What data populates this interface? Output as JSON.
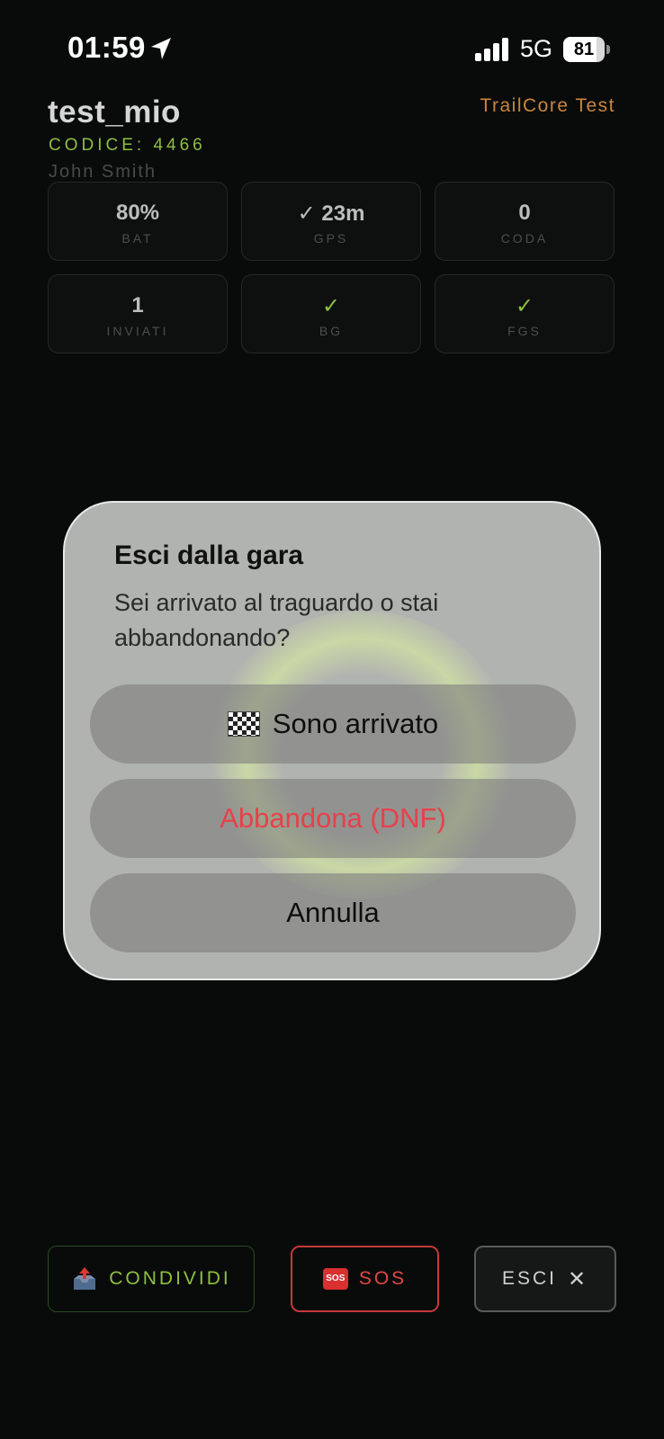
{
  "status_bar": {
    "time": "01:59",
    "network": "5G",
    "battery": "81",
    "battery_level": 0.81
  },
  "header": {
    "event_name": "test_mio",
    "app_name": "TrailCore Test",
    "code": "CODICE: 4466",
    "runner_name": "John Smith"
  },
  "stats": [
    {
      "value": "80%",
      "label": "BAT"
    },
    {
      "value": "✓ 23m",
      "label": "GPS"
    },
    {
      "value": "0",
      "label": "CODA"
    },
    {
      "value": "1",
      "label": "INVIATI"
    },
    {
      "value": "✓",
      "label": "BG"
    },
    {
      "value": "✓",
      "label": "FGS"
    }
  ],
  "bottom_bar": {
    "share_label": "CONDIVIDI",
    "sos_label": "SOS",
    "sos_icon_text": "SOS",
    "exit_label": "ESCI",
    "exit_icon": "✕"
  },
  "modal": {
    "title": "Esci dalla gara",
    "message": "Sei arrivato al traguardo o stai abbandonando?",
    "finish_label": "Sono arrivato",
    "dnf_label": "Abbandona (DNF)",
    "cancel_label": "Annulla"
  },
  "colors": {
    "accent_green": "#8fbf3f",
    "accent_orange": "#c9853d",
    "danger_red": "#e04848"
  },
  "icons": [
    "location-arrow-icon",
    "signal-icon",
    "battery-icon",
    "outbox-tray-icon",
    "sos-icon",
    "close-icon",
    "checkered-flag-icon"
  ]
}
